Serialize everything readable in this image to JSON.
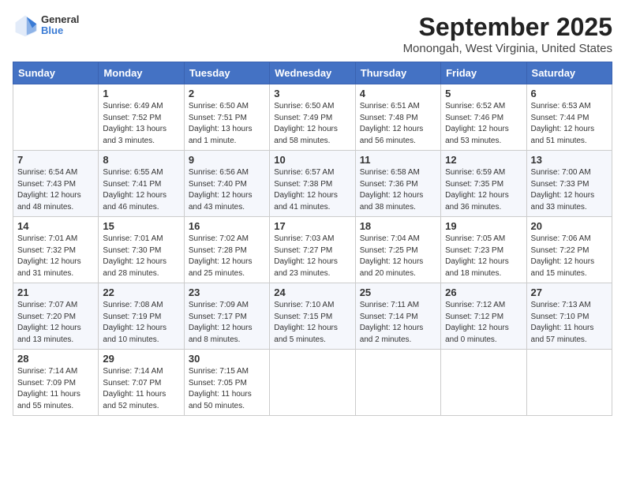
{
  "logo": {
    "general": "General",
    "blue": "Blue"
  },
  "title": "September 2025",
  "subtitle": "Monongah, West Virginia, United States",
  "days_of_week": [
    "Sunday",
    "Monday",
    "Tuesday",
    "Wednesday",
    "Thursday",
    "Friday",
    "Saturday"
  ],
  "weeks": [
    [
      {
        "day": "",
        "info": ""
      },
      {
        "day": "1",
        "info": "Sunrise: 6:49 AM\nSunset: 7:52 PM\nDaylight: 13 hours\nand 3 minutes."
      },
      {
        "day": "2",
        "info": "Sunrise: 6:50 AM\nSunset: 7:51 PM\nDaylight: 13 hours\nand 1 minute."
      },
      {
        "day": "3",
        "info": "Sunrise: 6:50 AM\nSunset: 7:49 PM\nDaylight: 12 hours\nand 58 minutes."
      },
      {
        "day": "4",
        "info": "Sunrise: 6:51 AM\nSunset: 7:48 PM\nDaylight: 12 hours\nand 56 minutes."
      },
      {
        "day": "5",
        "info": "Sunrise: 6:52 AM\nSunset: 7:46 PM\nDaylight: 12 hours\nand 53 minutes."
      },
      {
        "day": "6",
        "info": "Sunrise: 6:53 AM\nSunset: 7:44 PM\nDaylight: 12 hours\nand 51 minutes."
      }
    ],
    [
      {
        "day": "7",
        "info": "Sunrise: 6:54 AM\nSunset: 7:43 PM\nDaylight: 12 hours\nand 48 minutes."
      },
      {
        "day": "8",
        "info": "Sunrise: 6:55 AM\nSunset: 7:41 PM\nDaylight: 12 hours\nand 46 minutes."
      },
      {
        "day": "9",
        "info": "Sunrise: 6:56 AM\nSunset: 7:40 PM\nDaylight: 12 hours\nand 43 minutes."
      },
      {
        "day": "10",
        "info": "Sunrise: 6:57 AM\nSunset: 7:38 PM\nDaylight: 12 hours\nand 41 minutes."
      },
      {
        "day": "11",
        "info": "Sunrise: 6:58 AM\nSunset: 7:36 PM\nDaylight: 12 hours\nand 38 minutes."
      },
      {
        "day": "12",
        "info": "Sunrise: 6:59 AM\nSunset: 7:35 PM\nDaylight: 12 hours\nand 36 minutes."
      },
      {
        "day": "13",
        "info": "Sunrise: 7:00 AM\nSunset: 7:33 PM\nDaylight: 12 hours\nand 33 minutes."
      }
    ],
    [
      {
        "day": "14",
        "info": "Sunrise: 7:01 AM\nSunset: 7:32 PM\nDaylight: 12 hours\nand 31 minutes."
      },
      {
        "day": "15",
        "info": "Sunrise: 7:01 AM\nSunset: 7:30 PM\nDaylight: 12 hours\nand 28 minutes."
      },
      {
        "day": "16",
        "info": "Sunrise: 7:02 AM\nSunset: 7:28 PM\nDaylight: 12 hours\nand 25 minutes."
      },
      {
        "day": "17",
        "info": "Sunrise: 7:03 AM\nSunset: 7:27 PM\nDaylight: 12 hours\nand 23 minutes."
      },
      {
        "day": "18",
        "info": "Sunrise: 7:04 AM\nSunset: 7:25 PM\nDaylight: 12 hours\nand 20 minutes."
      },
      {
        "day": "19",
        "info": "Sunrise: 7:05 AM\nSunset: 7:23 PM\nDaylight: 12 hours\nand 18 minutes."
      },
      {
        "day": "20",
        "info": "Sunrise: 7:06 AM\nSunset: 7:22 PM\nDaylight: 12 hours\nand 15 minutes."
      }
    ],
    [
      {
        "day": "21",
        "info": "Sunrise: 7:07 AM\nSunset: 7:20 PM\nDaylight: 12 hours\nand 13 minutes."
      },
      {
        "day": "22",
        "info": "Sunrise: 7:08 AM\nSunset: 7:19 PM\nDaylight: 12 hours\nand 10 minutes."
      },
      {
        "day": "23",
        "info": "Sunrise: 7:09 AM\nSunset: 7:17 PM\nDaylight: 12 hours\nand 8 minutes."
      },
      {
        "day": "24",
        "info": "Sunrise: 7:10 AM\nSunset: 7:15 PM\nDaylight: 12 hours\nand 5 minutes."
      },
      {
        "day": "25",
        "info": "Sunrise: 7:11 AM\nSunset: 7:14 PM\nDaylight: 12 hours\nand 2 minutes."
      },
      {
        "day": "26",
        "info": "Sunrise: 7:12 AM\nSunset: 7:12 PM\nDaylight: 12 hours\nand 0 minutes."
      },
      {
        "day": "27",
        "info": "Sunrise: 7:13 AM\nSunset: 7:10 PM\nDaylight: 11 hours\nand 57 minutes."
      }
    ],
    [
      {
        "day": "28",
        "info": "Sunrise: 7:14 AM\nSunset: 7:09 PM\nDaylight: 11 hours\nand 55 minutes."
      },
      {
        "day": "29",
        "info": "Sunrise: 7:14 AM\nSunset: 7:07 PM\nDaylight: 11 hours\nand 52 minutes."
      },
      {
        "day": "30",
        "info": "Sunrise: 7:15 AM\nSunset: 7:05 PM\nDaylight: 11 hours\nand 50 minutes."
      },
      {
        "day": "",
        "info": ""
      },
      {
        "day": "",
        "info": ""
      },
      {
        "day": "",
        "info": ""
      },
      {
        "day": "",
        "info": ""
      }
    ]
  ]
}
